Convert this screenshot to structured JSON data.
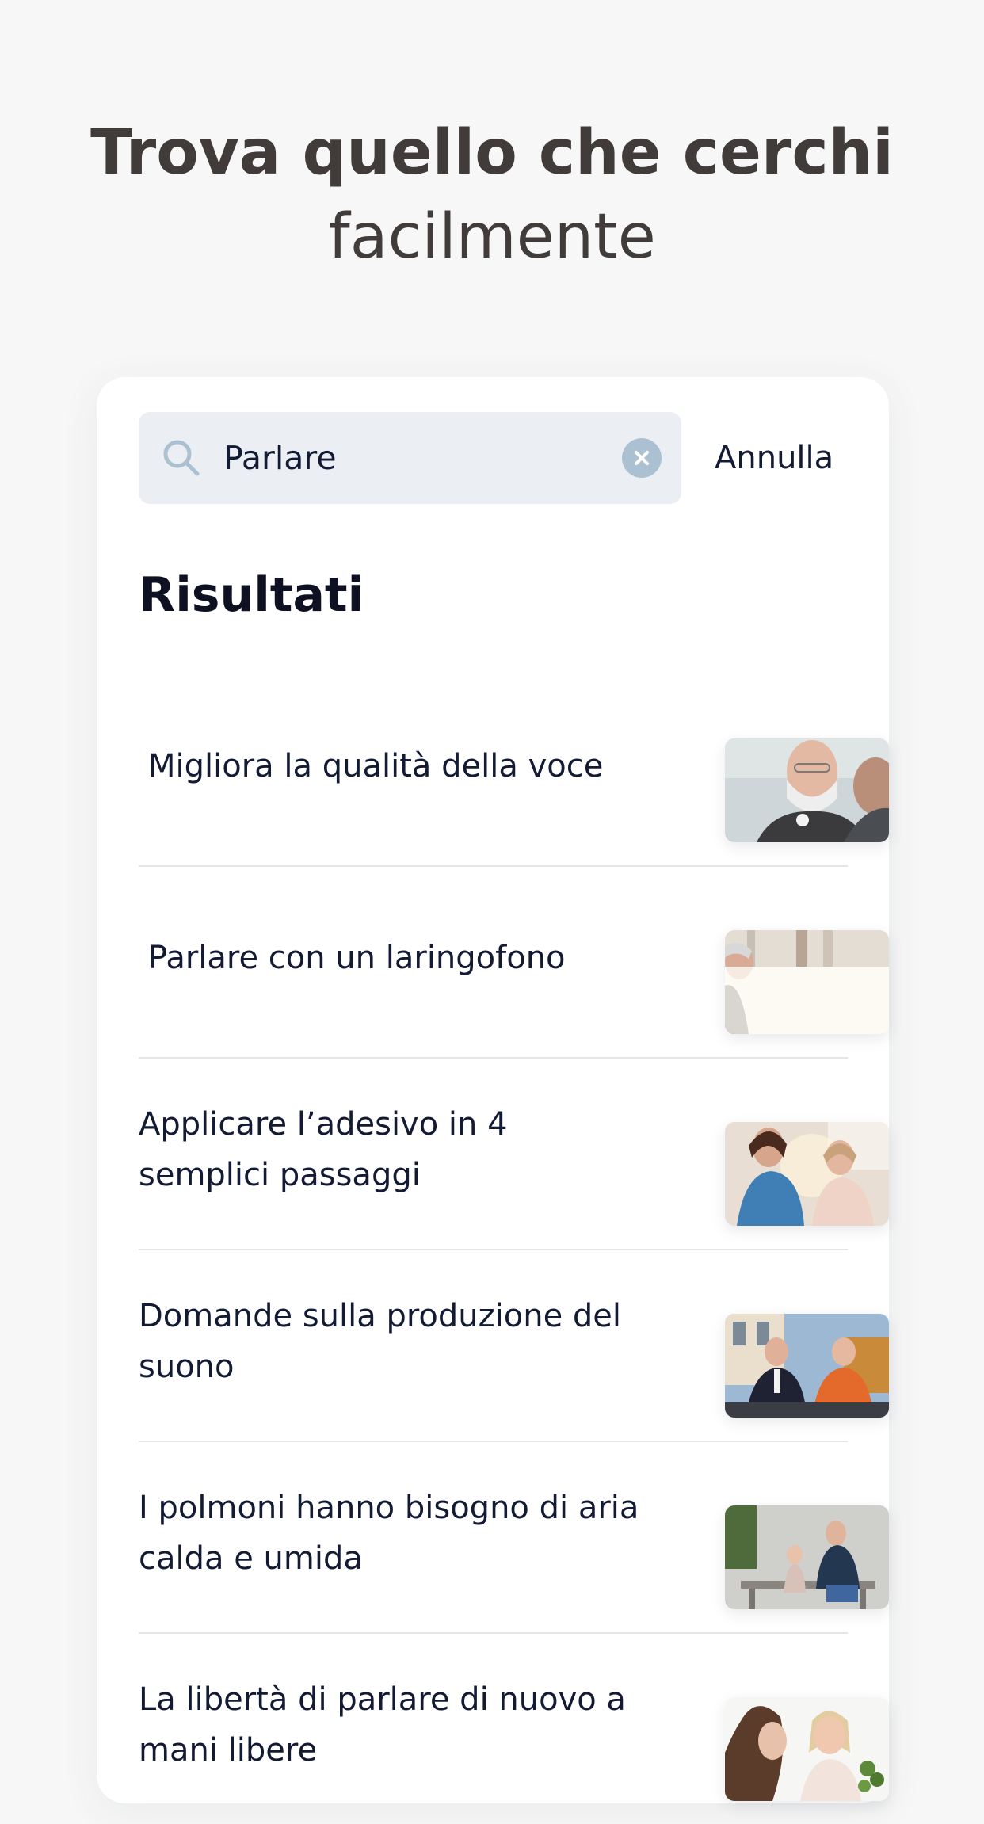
{
  "headline": {
    "bold": "Trova quello che cerchi",
    "light": "facilmente"
  },
  "search": {
    "value": "Parlare",
    "cancel_label": "Annulla",
    "icon": "search-icon",
    "clear_icon": "clear-icon"
  },
  "results": {
    "heading": "Risultati",
    "items": [
      {
        "title": "Migliora la qualità della voce",
        "image": "man-with-throat-device-photo"
      },
      {
        "title": "Parlare con un laringofono",
        "image": "people-talking-photo"
      },
      {
        "title": "Applicare l’adesivo in 4 semplici passaggi",
        "image": "nurse-with-patient-photo"
      },
      {
        "title": "Domande sulla produzione del suono",
        "image": "two-men-at-cafe-photo"
      },
      {
        "title": "I polmoni hanno bisogno di aria calda e umida",
        "image": "grandfather-and-child-on-bench-photo"
      },
      {
        "title": "La libertà di parlare di nuovo a mani libere",
        "image": "two-women-smiling-photo"
      }
    ]
  },
  "colors": {
    "background": "#f7f7f7",
    "headline": "#413c3a",
    "text": "#131a33",
    "search_field": "#ebeff3",
    "icon": "#abc0d0",
    "divider": "#e3e5e9"
  }
}
